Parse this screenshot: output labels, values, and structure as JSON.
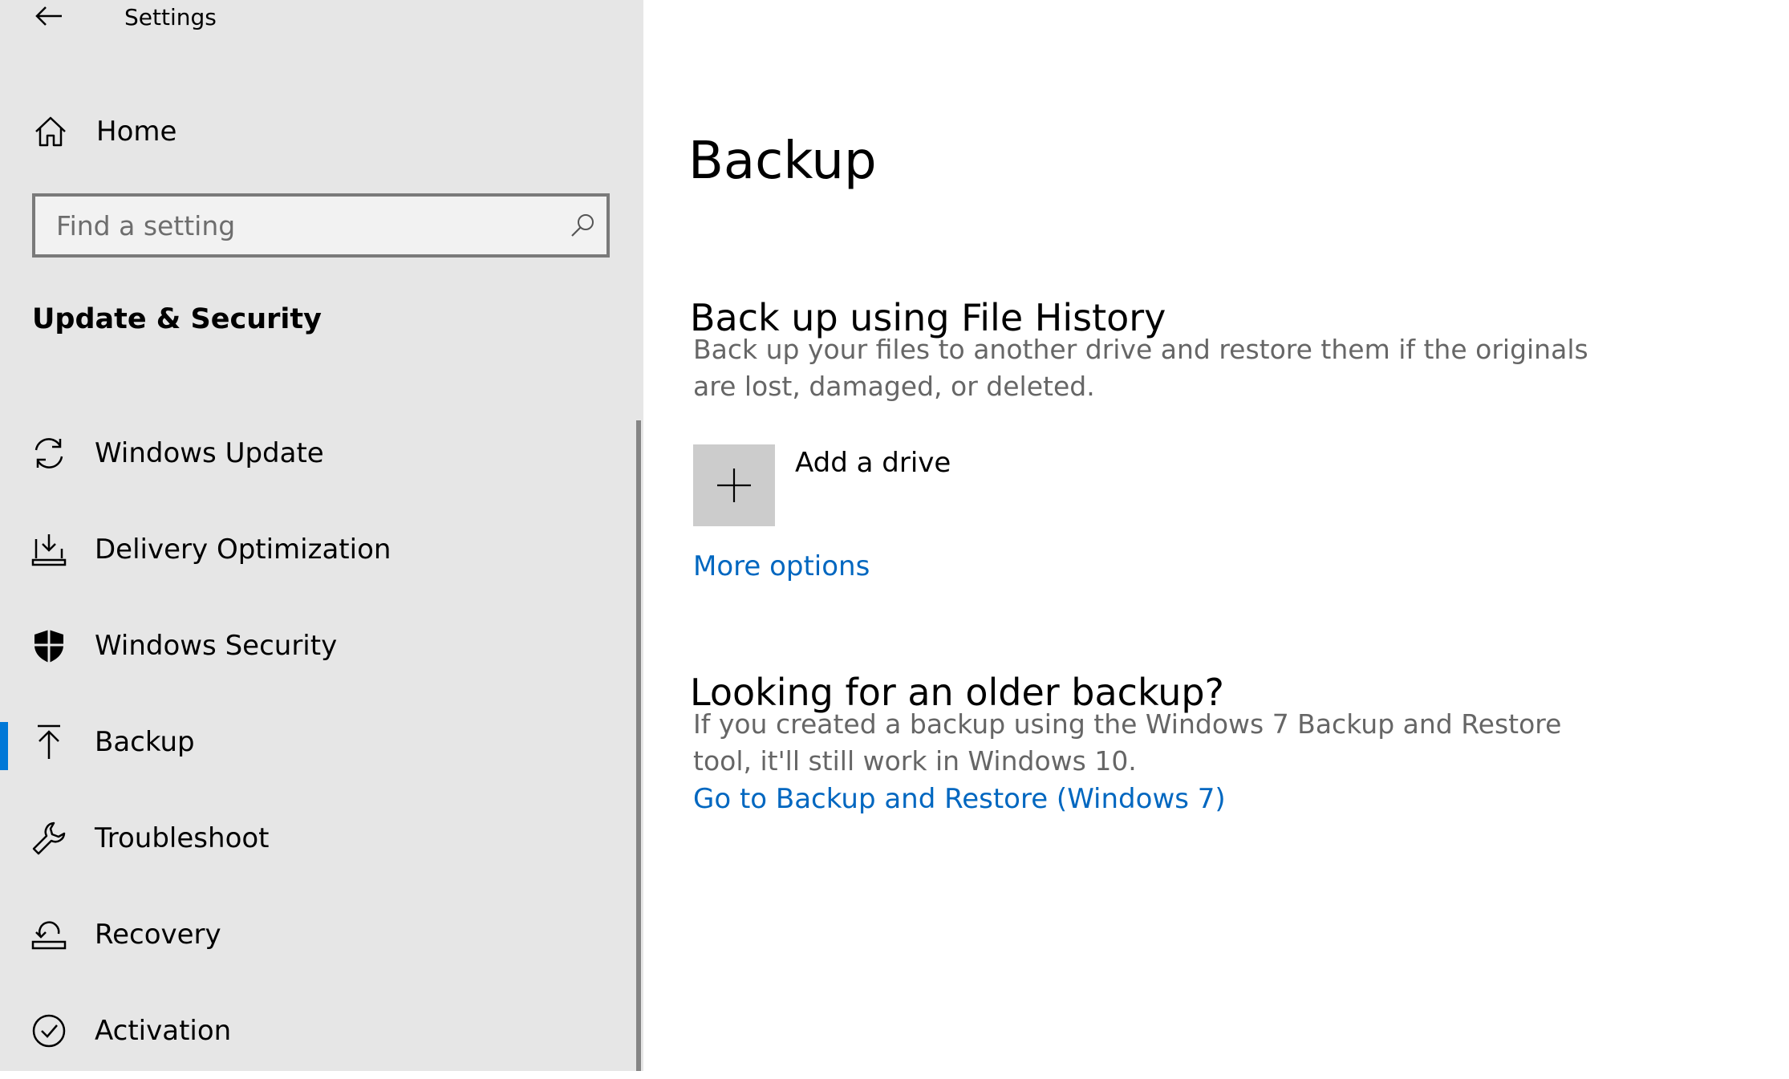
{
  "app": {
    "title": "Settings"
  },
  "sidebar": {
    "home_label": "Home",
    "search_placeholder": "Find a setting",
    "section_title": "Update & Security",
    "items": [
      {
        "label": "Windows Update",
        "icon": "sync-icon"
      },
      {
        "label": "Delivery Optimization",
        "icon": "delivery-optimization-icon"
      },
      {
        "label": "Windows Security",
        "icon": "shield-icon"
      },
      {
        "label": "Backup",
        "icon": "backup-arrow-icon",
        "selected": true
      },
      {
        "label": "Troubleshoot",
        "icon": "wrench-icon"
      },
      {
        "label": "Recovery",
        "icon": "recovery-icon"
      },
      {
        "label": "Activation",
        "icon": "check-circle-icon"
      }
    ]
  },
  "main": {
    "title": "Backup",
    "file_history": {
      "heading": "Back up using File History",
      "description": "Back up your files to another drive and restore them if the originals are lost, damaged, or deleted.",
      "add_drive_label": "Add a drive",
      "more_options_link": "More options"
    },
    "older_backup": {
      "heading": "Looking for an older backup?",
      "description": "If you created a backup using the Windows 7 Backup and Restore tool, it'll still work in Windows 10.",
      "link": "Go to Backup and Restore (Windows 7)"
    }
  },
  "colors": {
    "accent": "#0078d7",
    "link": "#0067c0",
    "sidebar_bg": "#e6e6e6",
    "secondary_text": "#666666"
  }
}
